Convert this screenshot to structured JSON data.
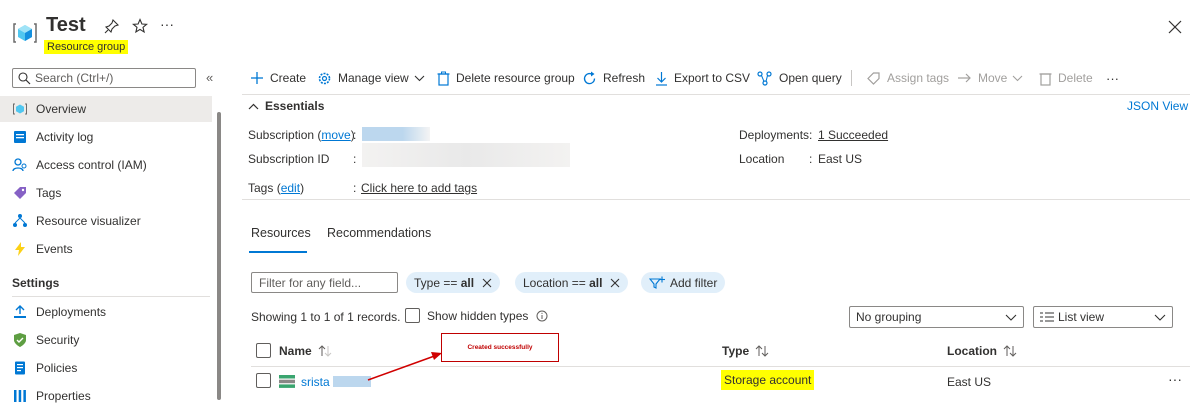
{
  "header": {
    "title": "Test",
    "subtitle": "Resource group",
    "pin_icon": "pin-icon",
    "star_icon": "star-icon",
    "more_icon": "more-icon",
    "close_icon": "close-icon"
  },
  "sidebar": {
    "search_placeholder": "Search (Ctrl+/)",
    "collapse_label": "«",
    "items": [
      {
        "label": "Overview",
        "icon": "overview-icon"
      },
      {
        "label": "Activity log",
        "icon": "activity-log-icon"
      },
      {
        "label": "Access control (IAM)",
        "icon": "iam-icon"
      },
      {
        "label": "Tags",
        "icon": "tag-icon"
      },
      {
        "label": "Resource visualizer",
        "icon": "visualizer-icon"
      },
      {
        "label": "Events",
        "icon": "lightning-icon"
      }
    ],
    "settings_heading": "Settings",
    "settings_items": [
      {
        "label": "Deployments",
        "icon": "deployments-icon"
      },
      {
        "label": "Security",
        "icon": "shield-icon"
      },
      {
        "label": "Policies",
        "icon": "policy-icon"
      },
      {
        "label": "Properties",
        "icon": "properties-icon"
      }
    ]
  },
  "toolbar": {
    "create": "Create",
    "manage_view": "Manage view",
    "delete_rg": "Delete resource group",
    "refresh": "Refresh",
    "export_csv": "Export to CSV",
    "open_query": "Open query",
    "assign_tags": "Assign tags",
    "move": "Move",
    "delete": "Delete",
    "more": "···"
  },
  "essentials": {
    "heading": "Essentials",
    "json_view": "JSON View",
    "subscription_label": "Subscription",
    "move_link": "move",
    "subscription_id_label": "Subscription ID",
    "tags_label": "Tags",
    "edit_link": "edit",
    "add_tags_link": "Click here to add tags",
    "deployments_label": "Deployments",
    "deployments_value": "1 Succeeded",
    "location_label": "Location",
    "location_value": "East US",
    "colon": ":"
  },
  "tabs": {
    "resources": "Resources",
    "recommendations": "Recommendations"
  },
  "filters": {
    "placeholder": "Filter for any field...",
    "type_prefix": "Type == ",
    "type_value": "all",
    "location_prefix": "Location == ",
    "location_value": "all",
    "add_filter": "Add filter"
  },
  "records": {
    "showing": "Showing 1 to 1 of 1 records.",
    "show_hidden": "Show hidden types",
    "grouping": "No grouping",
    "view": "List view"
  },
  "table": {
    "col_name": "Name",
    "col_type": "Type",
    "col_location": "Location",
    "rows": [
      {
        "name": "srista",
        "type": "Storage account",
        "location": "East US",
        "more": "···"
      }
    ]
  },
  "annotation": {
    "text": "Created successfully",
    "color": "#c00000"
  },
  "colors": {
    "accent": "#0078d4",
    "highlight": "#ffff00",
    "pill": "#e1effa"
  }
}
